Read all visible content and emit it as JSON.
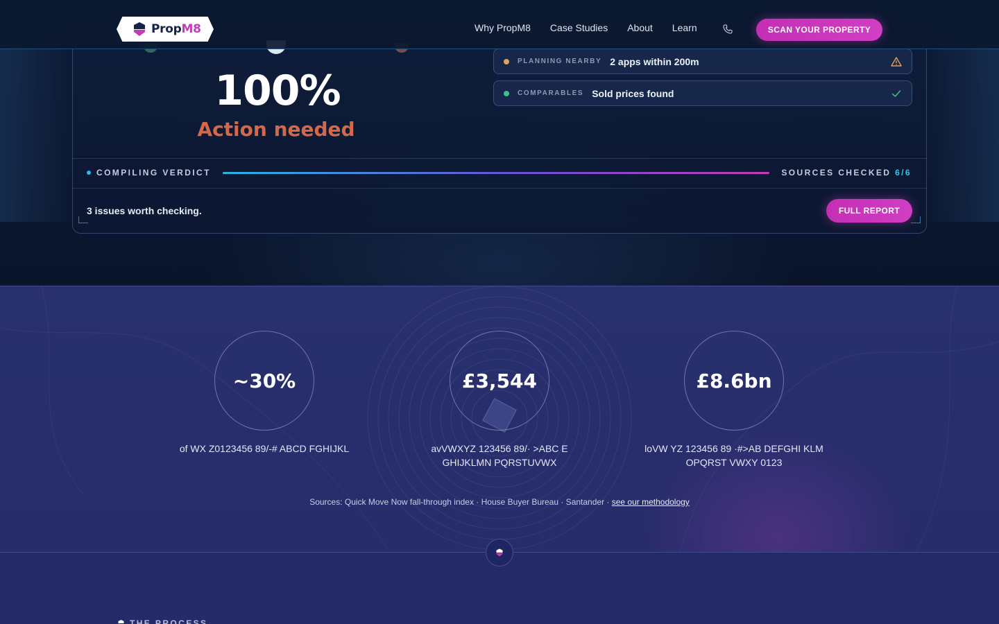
{
  "nav": {
    "brand_prefix": "Prop",
    "brand_suffix": "M8",
    "links": [
      "Why PropM8",
      "Case Studies",
      "About",
      "Learn"
    ],
    "phone_icon": "phone-icon",
    "cta_label": "SCAN YOUR PROPERTY"
  },
  "verdict": {
    "score": "100%",
    "status": "Action needed",
    "checks": [
      {
        "label": "PLANNING NEARBY",
        "value": "2 apps within 200m",
        "state": "warning",
        "icon": "warning-triangle-icon",
        "bullet_color": "#e0a15a"
      },
      {
        "label": "COMPARABLES",
        "value": "Sold prices found",
        "state": "ok",
        "icon": "check-icon",
        "bullet_color": "#3fbf8a"
      }
    ],
    "compiling_label": "COMPILING VERDICT",
    "progress": 1.0,
    "sources_label": "SOURCES CHECKED",
    "sources_count": "6/6",
    "issues_text": "3 issues worth checking.",
    "full_report_label": "FULL REPORT"
  },
  "stats": {
    "items": [
      {
        "value": "~30%",
        "caption": "of WX Z0123456 89/-# ABCD FGHIJKL"
      },
      {
        "value": "£3,544",
        "caption": "avVWXYZ 123456 89/· >ABC E GHIJKLMN PQRSTUVWX"
      },
      {
        "value": "£8.6bn",
        "caption": "loVW YZ 123456 89 ·#>AB DEFGHI KLM OPQRST VWXY 0123"
      }
    ],
    "sources_prefix": "Sources: Quick Move Now fall-through index · House Buyer Bureau · Santander · ",
    "methodology_link": "see our methodology"
  },
  "process": {
    "eyebrow": "THE PROCESS"
  },
  "colors": {
    "accent_magenta": "#c42fb4",
    "accent_cyan": "#2fb5e6",
    "status_orange": "#d4694a"
  }
}
